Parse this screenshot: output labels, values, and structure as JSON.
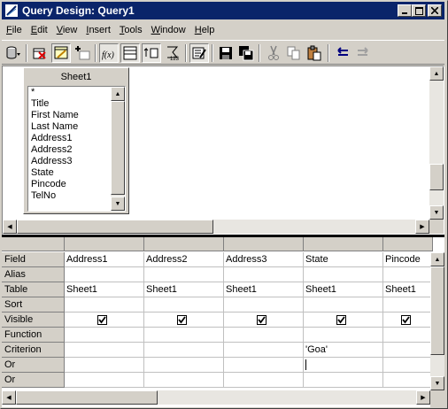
{
  "window": {
    "title": "Query Design: Query1"
  },
  "menu": {
    "items": [
      {
        "label": "File",
        "mn": "F",
        "rest": "ile"
      },
      {
        "label": "Edit",
        "mn": "E",
        "rest": "dit"
      },
      {
        "label": "View",
        "mn": "V",
        "rest": "iew"
      },
      {
        "label": "Insert",
        "mn": "I",
        "rest": "nsert"
      },
      {
        "label": "Tools",
        "mn": "T",
        "rest": "ools"
      },
      {
        "label": "Window",
        "mn": "W",
        "rest": "indow"
      },
      {
        "label": "Help",
        "mn": "H",
        "rest": "elp"
      }
    ]
  },
  "toolbar": {
    "icons": [
      "data-sources-icon",
      "delete-table-icon",
      "show-tables-icon",
      "add-table-icon",
      "functions-icon",
      "sort-criteria-icon",
      "sort-icon",
      "distinct-icon",
      "design-mode-icon",
      "save-icon",
      "save-as-icon",
      "cut-icon",
      "copy-icon",
      "paste-icon",
      "undo-icon",
      "redo-icon"
    ]
  },
  "table": {
    "name": "Sheet1",
    "fields": [
      "*",
      "Title",
      "First Name",
      "Last Name",
      "Address1",
      "Address2",
      "Address3",
      "State",
      "Pincode",
      "TelNo"
    ]
  },
  "grid": {
    "row_labels": [
      "Field",
      "Alias",
      "Table",
      "Sort",
      "Visible",
      "Function",
      "Criterion",
      "Or",
      "Or"
    ],
    "columns": [
      {
        "field": "Address1",
        "alias": "",
        "table": "Sheet1",
        "sort": "",
        "visible": true,
        "function": "",
        "criterion": "",
        "or1": "",
        "or2": ""
      },
      {
        "field": "Address2",
        "alias": "",
        "table": "Sheet1",
        "sort": "",
        "visible": true,
        "function": "",
        "criterion": "",
        "or1": "",
        "or2": ""
      },
      {
        "field": "Address3",
        "alias": "",
        "table": "Sheet1",
        "sort": "",
        "visible": true,
        "function": "",
        "criterion": "",
        "or1": "",
        "or2": ""
      },
      {
        "field": "State",
        "alias": "",
        "table": "Sheet1",
        "sort": "",
        "visible": true,
        "function": "",
        "criterion": "'Goa'",
        "or1": "",
        "or2": ""
      },
      {
        "field": "Pincode",
        "alias": "",
        "table": "Sheet1",
        "sort": "",
        "visible": true,
        "function": "",
        "criterion": "",
        "or1": "",
        "or2": ""
      }
    ]
  },
  "colors": {
    "titlebar": "#0a246a",
    "face": "#d4d0c8",
    "splitter": "#000000"
  }
}
